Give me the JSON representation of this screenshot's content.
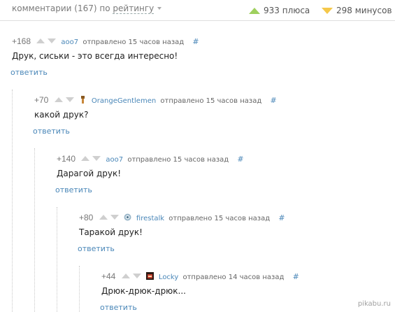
{
  "header": {
    "comments_label": "комментарии (167) по",
    "sort_value": "рейтингу",
    "plus_total": "933 плюса",
    "minus_total": "298 минусов"
  },
  "comments": [
    {
      "rating": "+168",
      "user": "aoo7",
      "time": "отправлено 15 часов назад",
      "hash": "#",
      "text": "Друк, сиськи - это всегда интересно!",
      "reply": "ответить"
    },
    {
      "rating": "+70",
      "user": "OrangeGentlemen",
      "time": "отправлено 15 часов назад",
      "hash": "#",
      "text": "какой друк?",
      "reply": "ответить"
    },
    {
      "rating": "+140",
      "user": "aoo7",
      "time": "отправлено 15 часов назад",
      "hash": "#",
      "text": "Дарагой друк!",
      "reply": "ответить"
    },
    {
      "rating": "+80",
      "user": "firestalk",
      "time": "отправлено 15 часов назад",
      "hash": "#",
      "text": "Таракой друк!",
      "reply": "ответить"
    },
    {
      "rating": "+44",
      "user": "Locky",
      "time": "отправлено 14 часов назад",
      "hash": "#",
      "text": "Дрюк-дрюк-дрюк...",
      "reply": "ответить"
    }
  ],
  "watermark": "pikabu.ru",
  "colors": {
    "link": "#4a87b8",
    "plus": "#9fd05e",
    "minus": "#f5c84a"
  }
}
